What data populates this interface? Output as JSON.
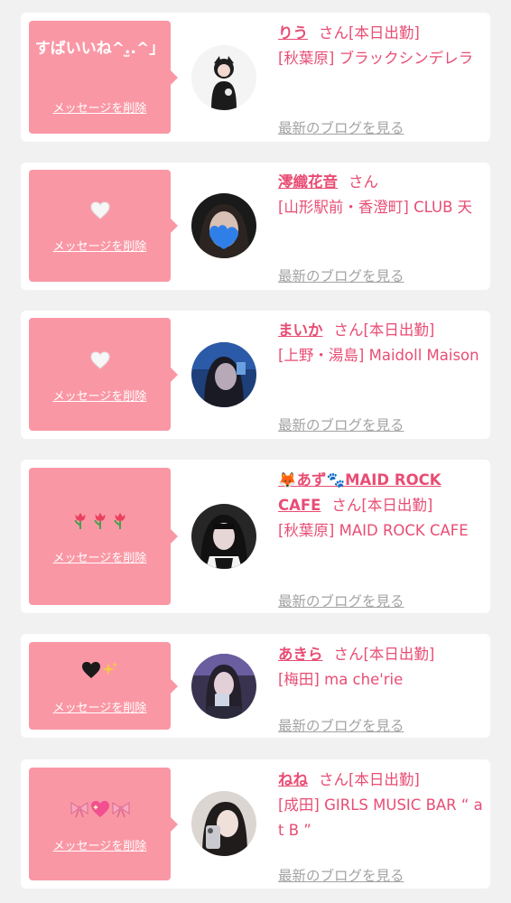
{
  "colors": {
    "background": "#f1f1f1",
    "card": "#ffffff",
    "bubble": "#fa97a5",
    "accent": "#e84d74",
    "muted": "#a3a3a3"
  },
  "items": [
    {
      "message": "すばいいね^.̫.^」",
      "delete_label": "メッセージを削除",
      "name": "りう",
      "honorific": "さん",
      "status": "[本日出勤]",
      "shop": "[秋葉原] ブラックシンデレラ",
      "blog_link": "最新のブログを見る",
      "avatar_icon": "profile-photo-icon"
    },
    {
      "message": "🤍",
      "delete_label": "メッセージを削除",
      "name": "澪織花音",
      "honorific": "さん",
      "status": "",
      "shop": "[山形駅前・香澄町] CLUB 天",
      "blog_link": "最新のブログを見る",
      "avatar_icon": "profile-photo-icon"
    },
    {
      "message": "🤍",
      "delete_label": "メッセージを削除",
      "name": "まいか",
      "honorific": "さん",
      "status": "[本日出勤]",
      "shop": "[上野・湯島] Maidoll Maison",
      "blog_link": "最新のブログを見る",
      "avatar_icon": "profile-photo-icon"
    },
    {
      "message": "🌷🌷🌷",
      "delete_label": "メッセージを削除",
      "name": "🦊あず🐾MAID ROCK CAFE",
      "name_part1": "🦊あず🐾MAID ROCK",
      "name_part2": "CAFE",
      "honorific": "さん",
      "status": "[本日出勤]",
      "shop": "[秋葉原] MAID ROCK CAFE",
      "blog_link": "最新のブログを見る",
      "avatar_icon": "profile-photo-icon"
    },
    {
      "message": "🖤✨",
      "delete_label": "メッセージを削除",
      "name": "あきら",
      "honorific": "さん",
      "status": "[本日出勤]",
      "shop": "[梅田] ma che'rie",
      "blog_link": "最新のブログを見る",
      "avatar_icon": "profile-photo-icon"
    },
    {
      "message": "🎀💖🎀",
      "delete_label": "メッセージを削除",
      "name": "ねね",
      "honorific": "さん",
      "status": "[本日出勤]",
      "shop": "[成田] GIRLS MUSIC BAR “ at B ”",
      "blog_link": "最新のブログを見る",
      "avatar_icon": "profile-photo-icon"
    }
  ]
}
